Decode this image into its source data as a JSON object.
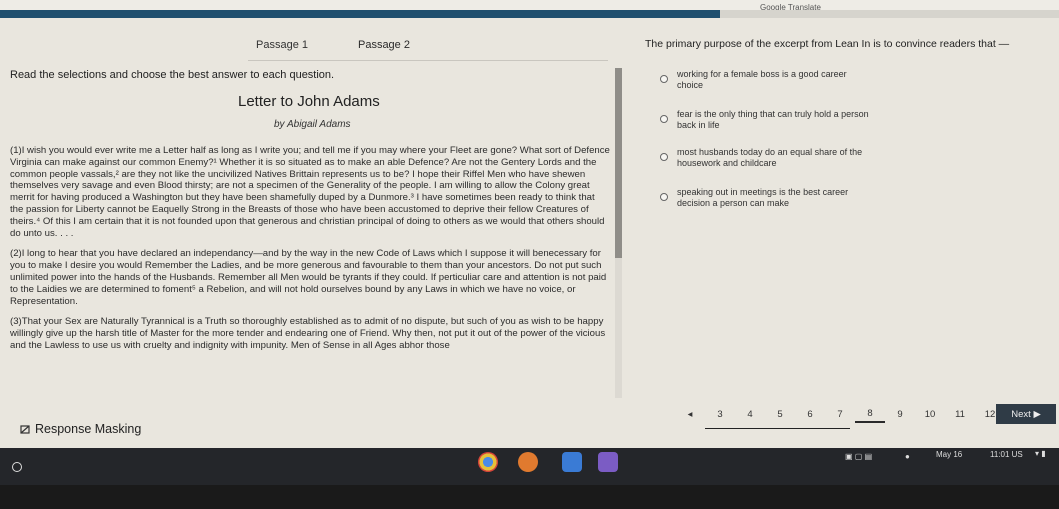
{
  "header": {
    "app_name": "Google Translate",
    "progress_percent": 68
  },
  "tabs": [
    {
      "label": "Passage 1"
    },
    {
      "label": "Passage 2"
    }
  ],
  "instruction": "Read the selections and choose the best answer to each question.",
  "passage": {
    "title": "Letter to John Adams",
    "byline": "by Abigail Adams",
    "paragraphs": [
      "(1)I wish you would ever write me a Letter half as long as I write you; and tell me if you may where your Fleet are gone? What sort of Defence Virginia can make against our common Enemy?¹ Whether it is so situated as to make an able Defence? Are not the Gentery Lords and the common people vassals,² are they not like the uncivilized Natives Brittain represents us to be? I hope their Riffel Men who have shewen themselves very savage and even Blood thirsty; are not a specimen of the Generality of the people. I am willing to allow the Colony great merrit for having produced a Washington but they have been shamefully duped by a Dunmore.³ I have sometimes been ready to think that the passion for Liberty cannot be Eaquelly Strong in the Breasts of those who have been accustomed to deprive their fellow Creatures of theirs.⁴ Of this I am certain that it is not founded upon that generous and christian principal of doing to others as we would that others should do unto us. . . .",
      "(2)I long to hear that you have declared an independancy—and by the way in the new Code of Laws which I suppose it will benecessary for you to make I desire you would Remember the Ladies, and be more generous and favourable to them than your ancestors. Do not put such unlimited power into the hands of the Husbands. Remember all Men would be tyrants if they could. If perticuliar care and attention is not paid to the Laidies we are determined to foment⁵ a Rebelion, and will not hold ourselves bound by any Laws in which we have no voice, or Representation.",
      "(3)That your Sex are Naturally Tyrannical is a Truth so thoroughly established as to admit of no dispute, but such of you as wish to be happy willingly give up the harsh title of Master for the more tender and endearing one of Friend. Why then, not put it out of the power of the vicious and the Lawless to use us with cruelty and indignity with impunity. Men of Sense in all Ages abhor those"
    ]
  },
  "question": {
    "prompt": "The primary purpose of the excerpt from Lean In is to convince readers that —",
    "choices": [
      {
        "text": "working for a female boss is a good career choice"
      },
      {
        "text": "fear is the only thing that can truly hold a person back in life"
      },
      {
        "text": "most husbands today do an equal share of the housework and childcare"
      },
      {
        "text": "speaking out in meetings is the best career decision a person can make"
      }
    ]
  },
  "footer": {
    "response_masking": "Response Masking",
    "pages": [
      "3",
      "4",
      "5",
      "6",
      "7",
      "8",
      "9",
      "10",
      "11",
      "12"
    ],
    "current_page": "8",
    "next_label": "Next"
  },
  "system_tray": {
    "date": "May 16",
    "time": "11:01 US"
  },
  "colors": {
    "accent": "#1f4f6e",
    "next_button": "#2f3b46",
    "shelf": "#24262a"
  }
}
